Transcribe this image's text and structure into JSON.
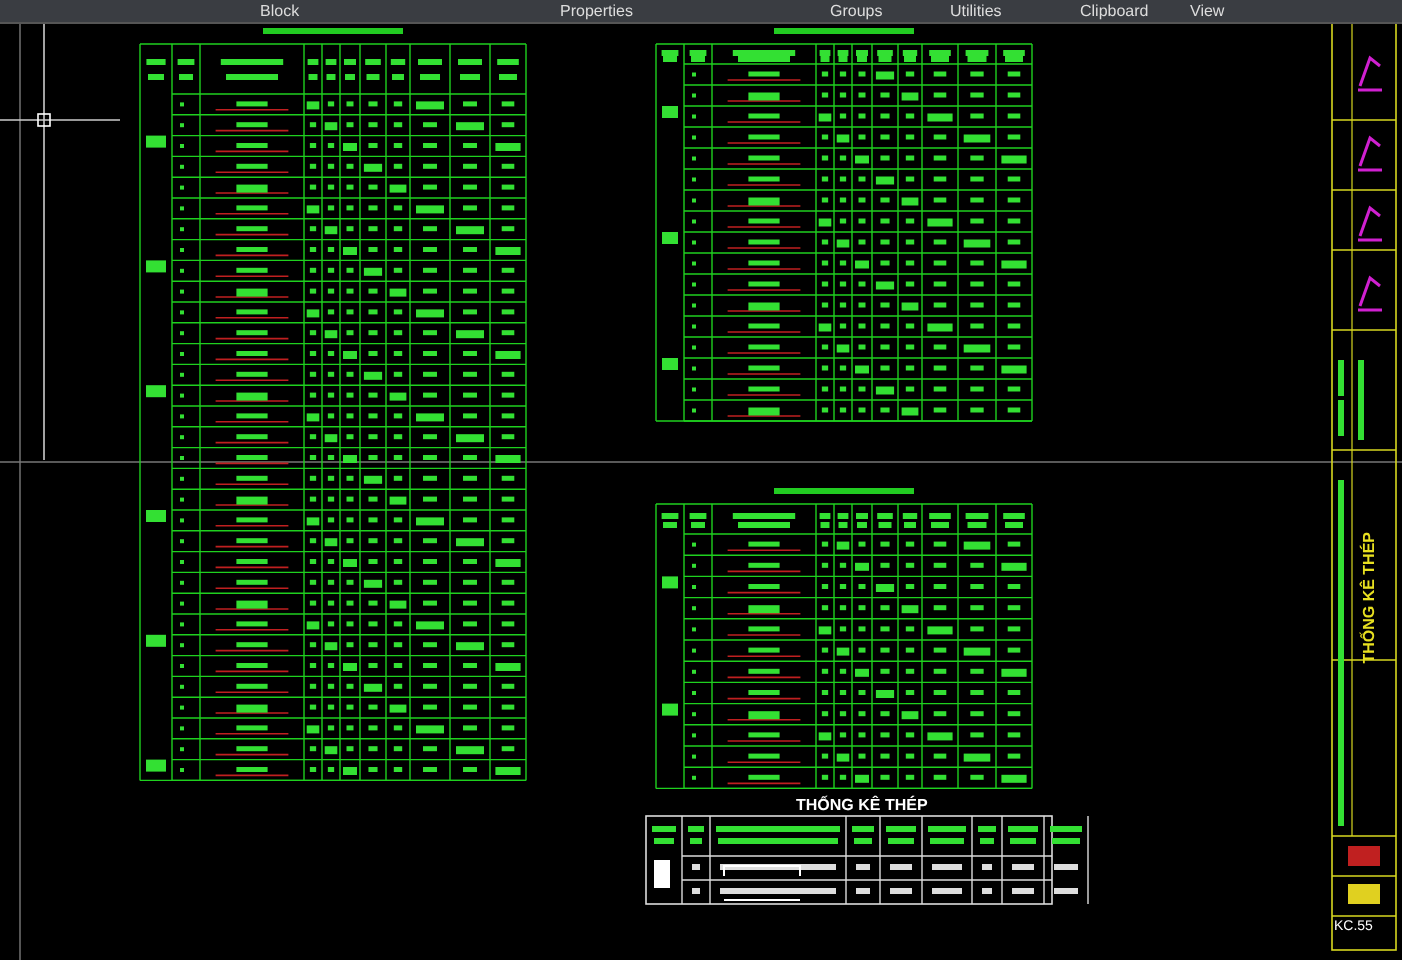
{
  "ribbon": {
    "panels": [
      {
        "label": "Block"
      },
      {
        "label": "Properties"
      },
      {
        "label": "Groups"
      },
      {
        "label": "Utilities"
      },
      {
        "label": "Clipboard"
      },
      {
        "label": "View"
      }
    ]
  },
  "summary_table": {
    "title": "THỐNG KÊ THÉP"
  },
  "title_block": {
    "sheet_title": "THỐNG KÊ THÉP",
    "sheet_number": "KC.55"
  }
}
